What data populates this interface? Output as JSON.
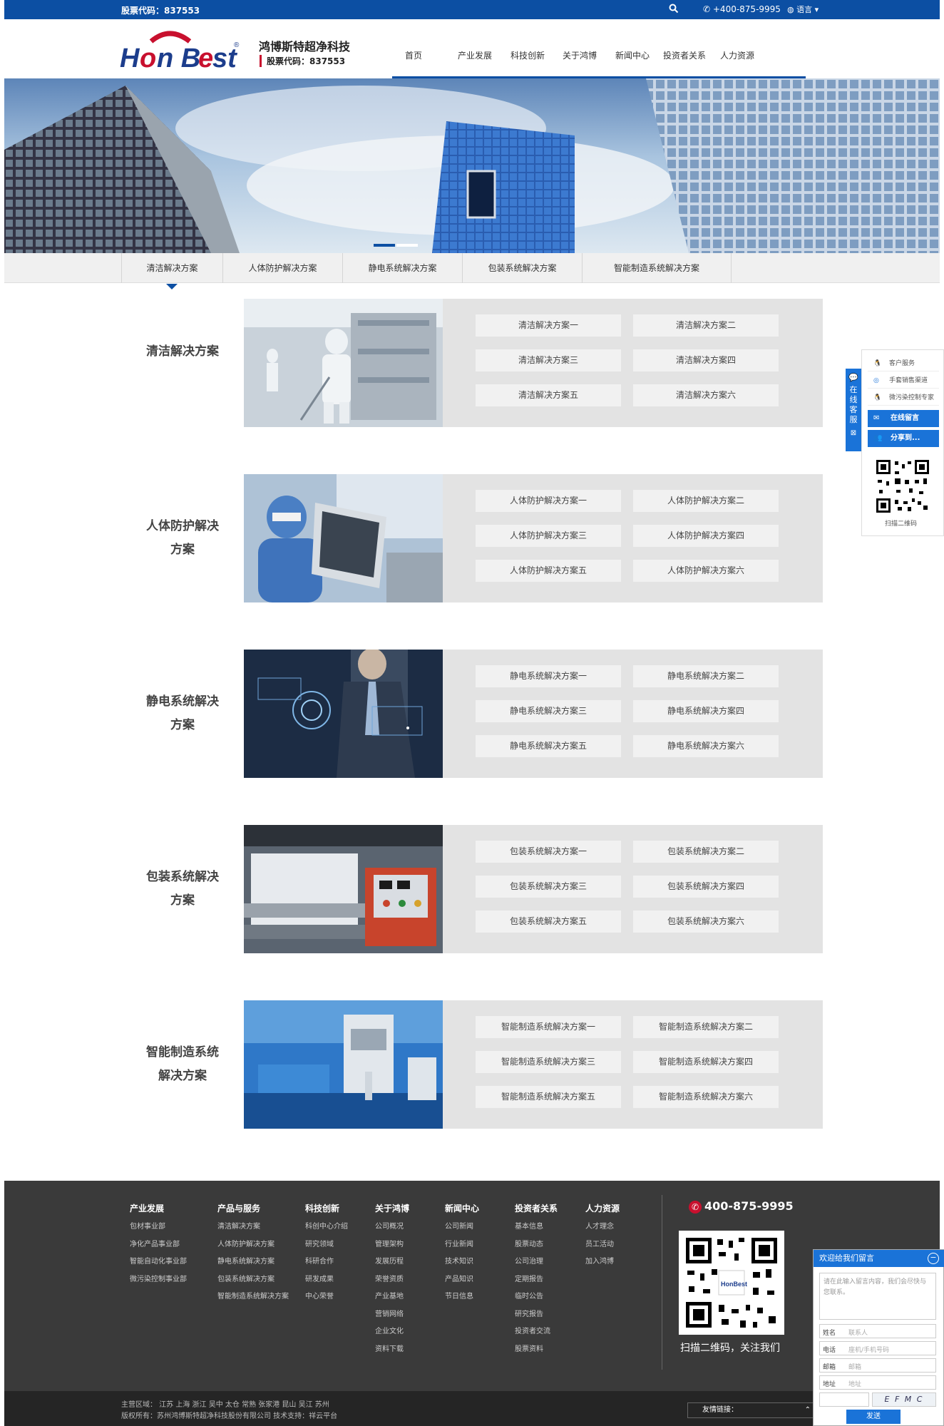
{
  "topbar": {
    "stock_code": "股票代码：837553",
    "phone": "+400-875-9995",
    "language": "语言"
  },
  "brand": {
    "logo_text": "HonBest",
    "name": "鸿博斯特超净科技",
    "stock": "股票代码：837553"
  },
  "nav": [
    "首页",
    "产业发展",
    "科技创新",
    "关于鸿博",
    "新闻中心",
    "投资者关系",
    "人力资源"
  ],
  "tabs": [
    "清洁解决方案",
    "人体防护解决方案",
    "静电系统解决方案",
    "包装系统解决方案",
    "智能制造系统解决方案"
  ],
  "sections": [
    {
      "title_l1": "清洁解决方案",
      "title_l2": "",
      "items": [
        "清洁解决方案一",
        "清洁解决方案二",
        "清洁解决方案三",
        "清洁解决方案四",
        "清洁解决方案五",
        "清洁解决方案六"
      ]
    },
    {
      "title_l1": "人体防护解决",
      "title_l2": "方案",
      "items": [
        "人体防护解决方案一",
        "人体防护解决方案二",
        "人体防护解决方案三",
        "人体防护解决方案四",
        "人体防护解决方案五",
        "人体防护解决方案六"
      ]
    },
    {
      "title_l1": "静电系统解决",
      "title_l2": "方案",
      "items": [
        "静电系统解决方案一",
        "静电系统解决方案二",
        "静电系统解决方案三",
        "静电系统解决方案四",
        "静电系统解决方案五",
        "静电系统解决方案六"
      ]
    },
    {
      "title_l1": "包装系统解决",
      "title_l2": "方案",
      "items": [
        "包装系统解决方案一",
        "包装系统解决方案二",
        "包装系统解决方案三",
        "包装系统解决方案四",
        "包装系统解决方案五",
        "包装系统解决方案六"
      ]
    },
    {
      "title_l1": "智能制造系统",
      "title_l2": "解决方案",
      "items": [
        "智能制造系统解决方案一",
        "智能制造系统解决方案二",
        "智能制造系统解决方案三",
        "智能制造系统解决方案四",
        "智能制造系统解决方案五",
        "智能制造系统解决方案六"
      ]
    }
  ],
  "footer": {
    "columns": [
      {
        "heading": "产业发展",
        "items": [
          "包材事业部",
          "净化产品事业部",
          "智能自动化事业部",
          "微污染控制事业部"
        ]
      },
      {
        "heading": "产品与服务",
        "items": [
          "清洁解决方案",
          "人体防护解决方案",
          "静电系统解决方案",
          "包装系统解决方案",
          "智能制造系统解决方案"
        ]
      },
      {
        "heading": "科技创新",
        "items": [
          "科创中心介绍",
          "研究领域",
          "科研合作",
          "研发成果",
          "中心荣誉"
        ]
      },
      {
        "heading": "关于鸿博",
        "items": [
          "公司概况",
          "管理架构",
          "发展历程",
          "荣誉资质",
          "产业基地",
          "营销网络",
          "企业文化",
          "资料下载"
        ]
      },
      {
        "heading": "新闻中心",
        "items": [
          "公司新闻",
          "行业新闻",
          "技术知识",
          "产品知识",
          "节日信息"
        ]
      },
      {
        "heading": "投资者关系",
        "items": [
          "基本信息",
          "股票动态",
          "公司治理",
          "定期报告",
          "临时公告",
          "研究报告",
          "投资者交流",
          "股票资料"
        ]
      },
      {
        "heading": "人力资源",
        "items": [
          "人才理念",
          "员工活动",
          "加入鸿博"
        ]
      }
    ],
    "phone": "400-875-9995",
    "qr_caption": "扫描二维码，关注我们"
  },
  "bottom": {
    "regions": "主营区域： 江苏 上海 浙江 吴中 太仓 常熟 张家港 昆山 吴江 苏州",
    "copyright": "版权所有：苏州鸿博斯特超净科技股份有限公司 技术支持：祥云平台",
    "friend_links": "友情链接："
  },
  "side_service": {
    "tab_label": "在线客服",
    "items": [
      "客户服务",
      "手套销售渠道",
      "微污染控制专家"
    ],
    "message": "在线留言",
    "share": "分享到...",
    "qr_caption": "扫描二维码"
  },
  "message_box": {
    "title": "欢迎给我们留言",
    "placeholder": "请在此输入留言内容，我们会尽快与您联系。",
    "name_label": "姓名",
    "name_ph": "联系人",
    "phone_label": "电话",
    "phone_ph": "座机/手机号码",
    "email_label": "邮箱",
    "email_ph": "邮箱",
    "addr_label": "地址",
    "addr_ph": "地址",
    "captcha": "E F M C",
    "send": "发送"
  }
}
